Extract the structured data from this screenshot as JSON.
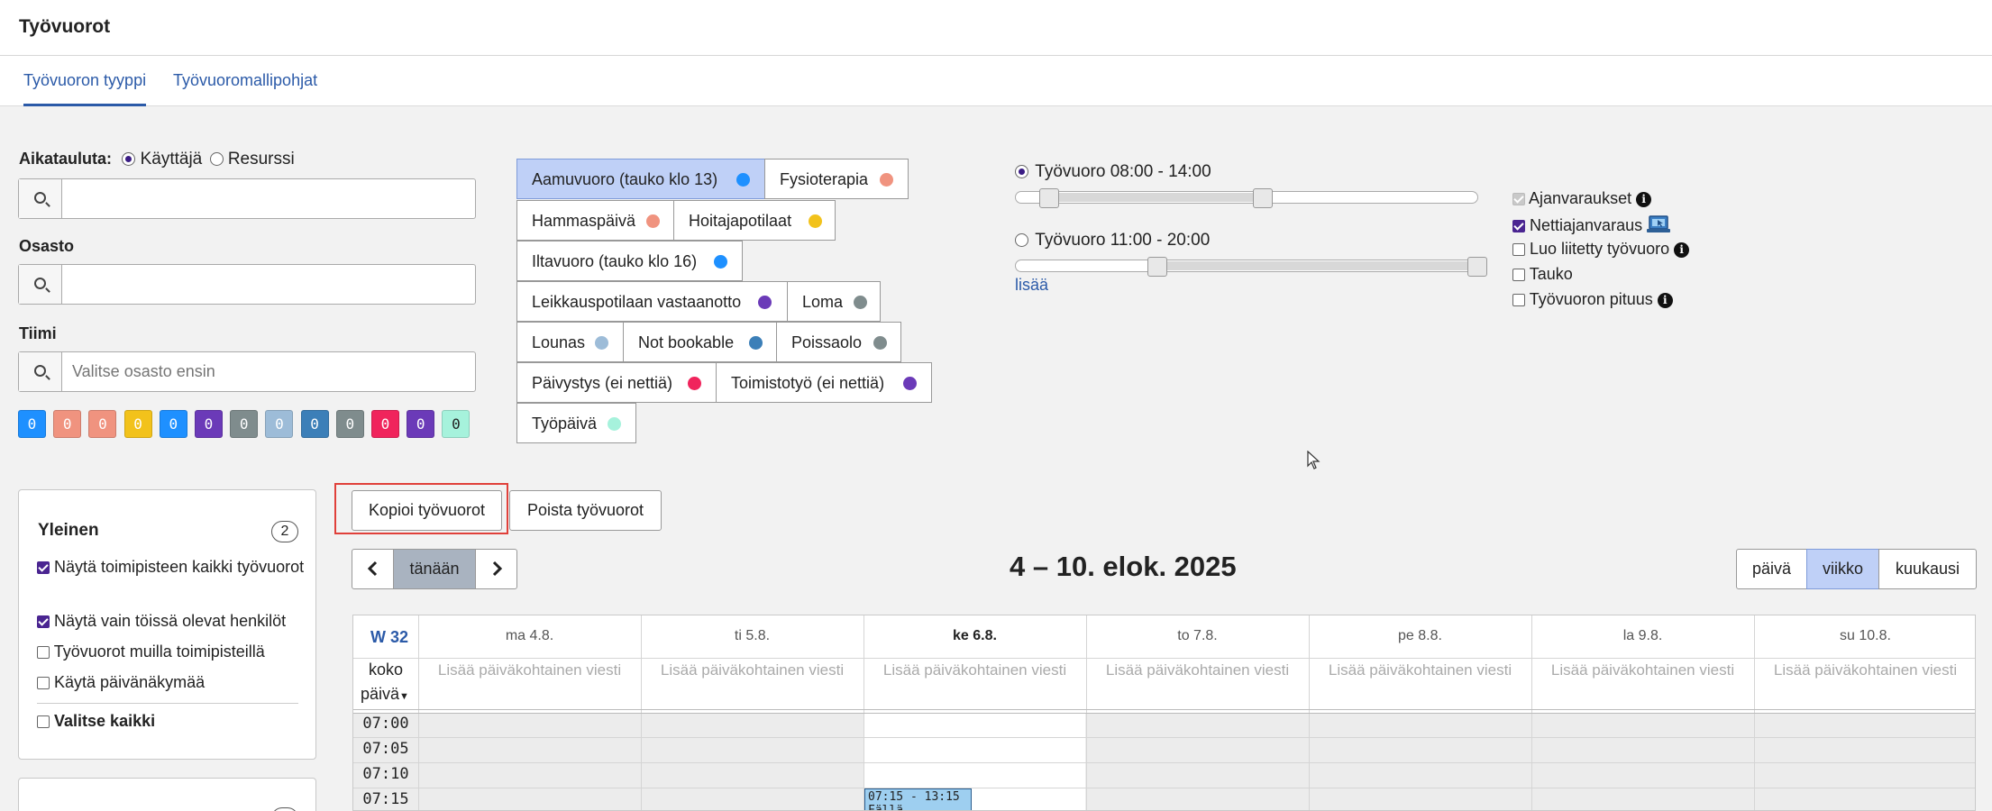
{
  "app": {
    "title": "Työvuorot"
  },
  "tabs": [
    {
      "label": "Työvuoron tyyppi",
      "active": true
    },
    {
      "label": "Työvuoromallipohjat",
      "active": false
    }
  ],
  "filters": {
    "schedule_label": "Aikatauluta:",
    "schedule_options": [
      "Käyttäjä",
      "Resurssi"
    ],
    "schedule_selected": "Käyttäjä",
    "user_search_value": "",
    "department_label": "Osasto",
    "department_value": "",
    "team_label": "Tiimi",
    "team_placeholder": "Valitse osasto ensin"
  },
  "color_counters": [
    {
      "value": "0",
      "color": "#1e90ff"
    },
    {
      "value": "0",
      "color": "#f0937f"
    },
    {
      "value": "0",
      "color": "#f0937f"
    },
    {
      "value": "0",
      "color": "#f2c21b"
    },
    {
      "value": "0",
      "color": "#1e90ff"
    },
    {
      "value": "0",
      "color": "#6b3ab8"
    },
    {
      "value": "0",
      "color": "#7f8c8d"
    },
    {
      "value": "0",
      "color": "#9dbcd8"
    },
    {
      "value": "0",
      "color": "#3c7fb8"
    },
    {
      "value": "0",
      "color": "#7f8c8d"
    },
    {
      "value": "0",
      "color": "#f0245c"
    },
    {
      "value": "0",
      "color": "#6b3ab8"
    },
    {
      "value": "0",
      "color": "#a6f2dc"
    }
  ],
  "shift_types": [
    {
      "label": "Aamuvuoro (tauko klo 13)",
      "color": "#1e90ff",
      "selected": true
    },
    {
      "label": "Fysioterapia",
      "color": "#f0937f"
    },
    {
      "label": "Hammaspäivä",
      "color": "#f0937f"
    },
    {
      "label": "Hoitajapotilaat",
      "color": "#f2c21b"
    },
    {
      "label": "Iltavuoro (tauko klo 16)",
      "color": "#1e90ff"
    },
    {
      "label": "Leikkauspotilaan vastaanotto",
      "color": "#6b3ab8"
    },
    {
      "label": "Loma",
      "color": "#7f8c8d"
    },
    {
      "label": "Lounas",
      "color": "#9dbcd8"
    },
    {
      "label": "Not bookable",
      "color": "#3c7fb8"
    },
    {
      "label": "Poissaolo",
      "color": "#7f8c8d"
    },
    {
      "label": "Päivystys (ei nettiä)",
      "color": "#f0245c"
    },
    {
      "label": "Toimistotyö (ei nettiä)",
      "color": "#6b3ab8"
    },
    {
      "label": "Työpäivä",
      "color": "#a6f2dc"
    }
  ],
  "shift_ranges": [
    {
      "label": "Työvuoro 08:00 - 14:00",
      "selected": true
    },
    {
      "label": "Työvuoro 11:00 - 20:00",
      "selected": false
    }
  ],
  "add_more_link": "lisää",
  "options": [
    {
      "label": "Ajanvaraukset",
      "checked": true,
      "disabled": true,
      "info": true
    },
    {
      "label": "Nettiajanvaraus",
      "checked": true,
      "icon": "web-booking-icon"
    },
    {
      "label": "Luo liitetty työvuoro",
      "checked": false,
      "info": true
    },
    {
      "label": "Tauko",
      "checked": false
    },
    {
      "label": "Työvuoron pituus",
      "checked": false,
      "info": true
    }
  ],
  "general_panel": {
    "title": "Yleinen",
    "count": "2",
    "items": [
      {
        "label": "Näytä toimipisteen kaikki työvuorot",
        "checked": true
      },
      {
        "label": "Näytä vain töissä olevat henkilöt",
        "checked": true
      },
      {
        "label": "Työvuorot muilla toimipisteillä",
        "checked": false
      },
      {
        "label": "Käytä päivänäkymää",
        "checked": false
      }
    ],
    "select_all": "Valitse kaikki"
  },
  "actions": {
    "copy_shifts": "Kopioi työvuorot",
    "delete_shifts": "Poista työvuorot"
  },
  "calendar": {
    "nav": {
      "prev": "‹",
      "today": "tänään",
      "next": "›"
    },
    "range_title": "4 – 10. elok. 2025",
    "views": [
      {
        "label": "päivä",
        "active": false
      },
      {
        "label": "viikko",
        "active": true
      },
      {
        "label": "kuukausi",
        "active": false
      }
    ],
    "week_label": "W 32",
    "allday_label_1": "koko",
    "allday_label_2": "päivä",
    "days": [
      {
        "label": "ma 4.8.",
        "today": false
      },
      {
        "label": "ti 5.8.",
        "today": false
      },
      {
        "label": "ke 6.8.",
        "today": true
      },
      {
        "label": "to 7.8.",
        "today": false
      },
      {
        "label": "pe 8.8.",
        "today": false
      },
      {
        "label": "la 9.8.",
        "today": false
      },
      {
        "label": "su 10.8.",
        "today": false
      }
    ],
    "day_note_placeholder": "Lisää päiväkohtainen viesti",
    "times": [
      "07:00",
      "07:05",
      "07:10",
      "07:15"
    ],
    "event": {
      "time": "07:15 - 13:15",
      "title": "Fällä"
    }
  }
}
